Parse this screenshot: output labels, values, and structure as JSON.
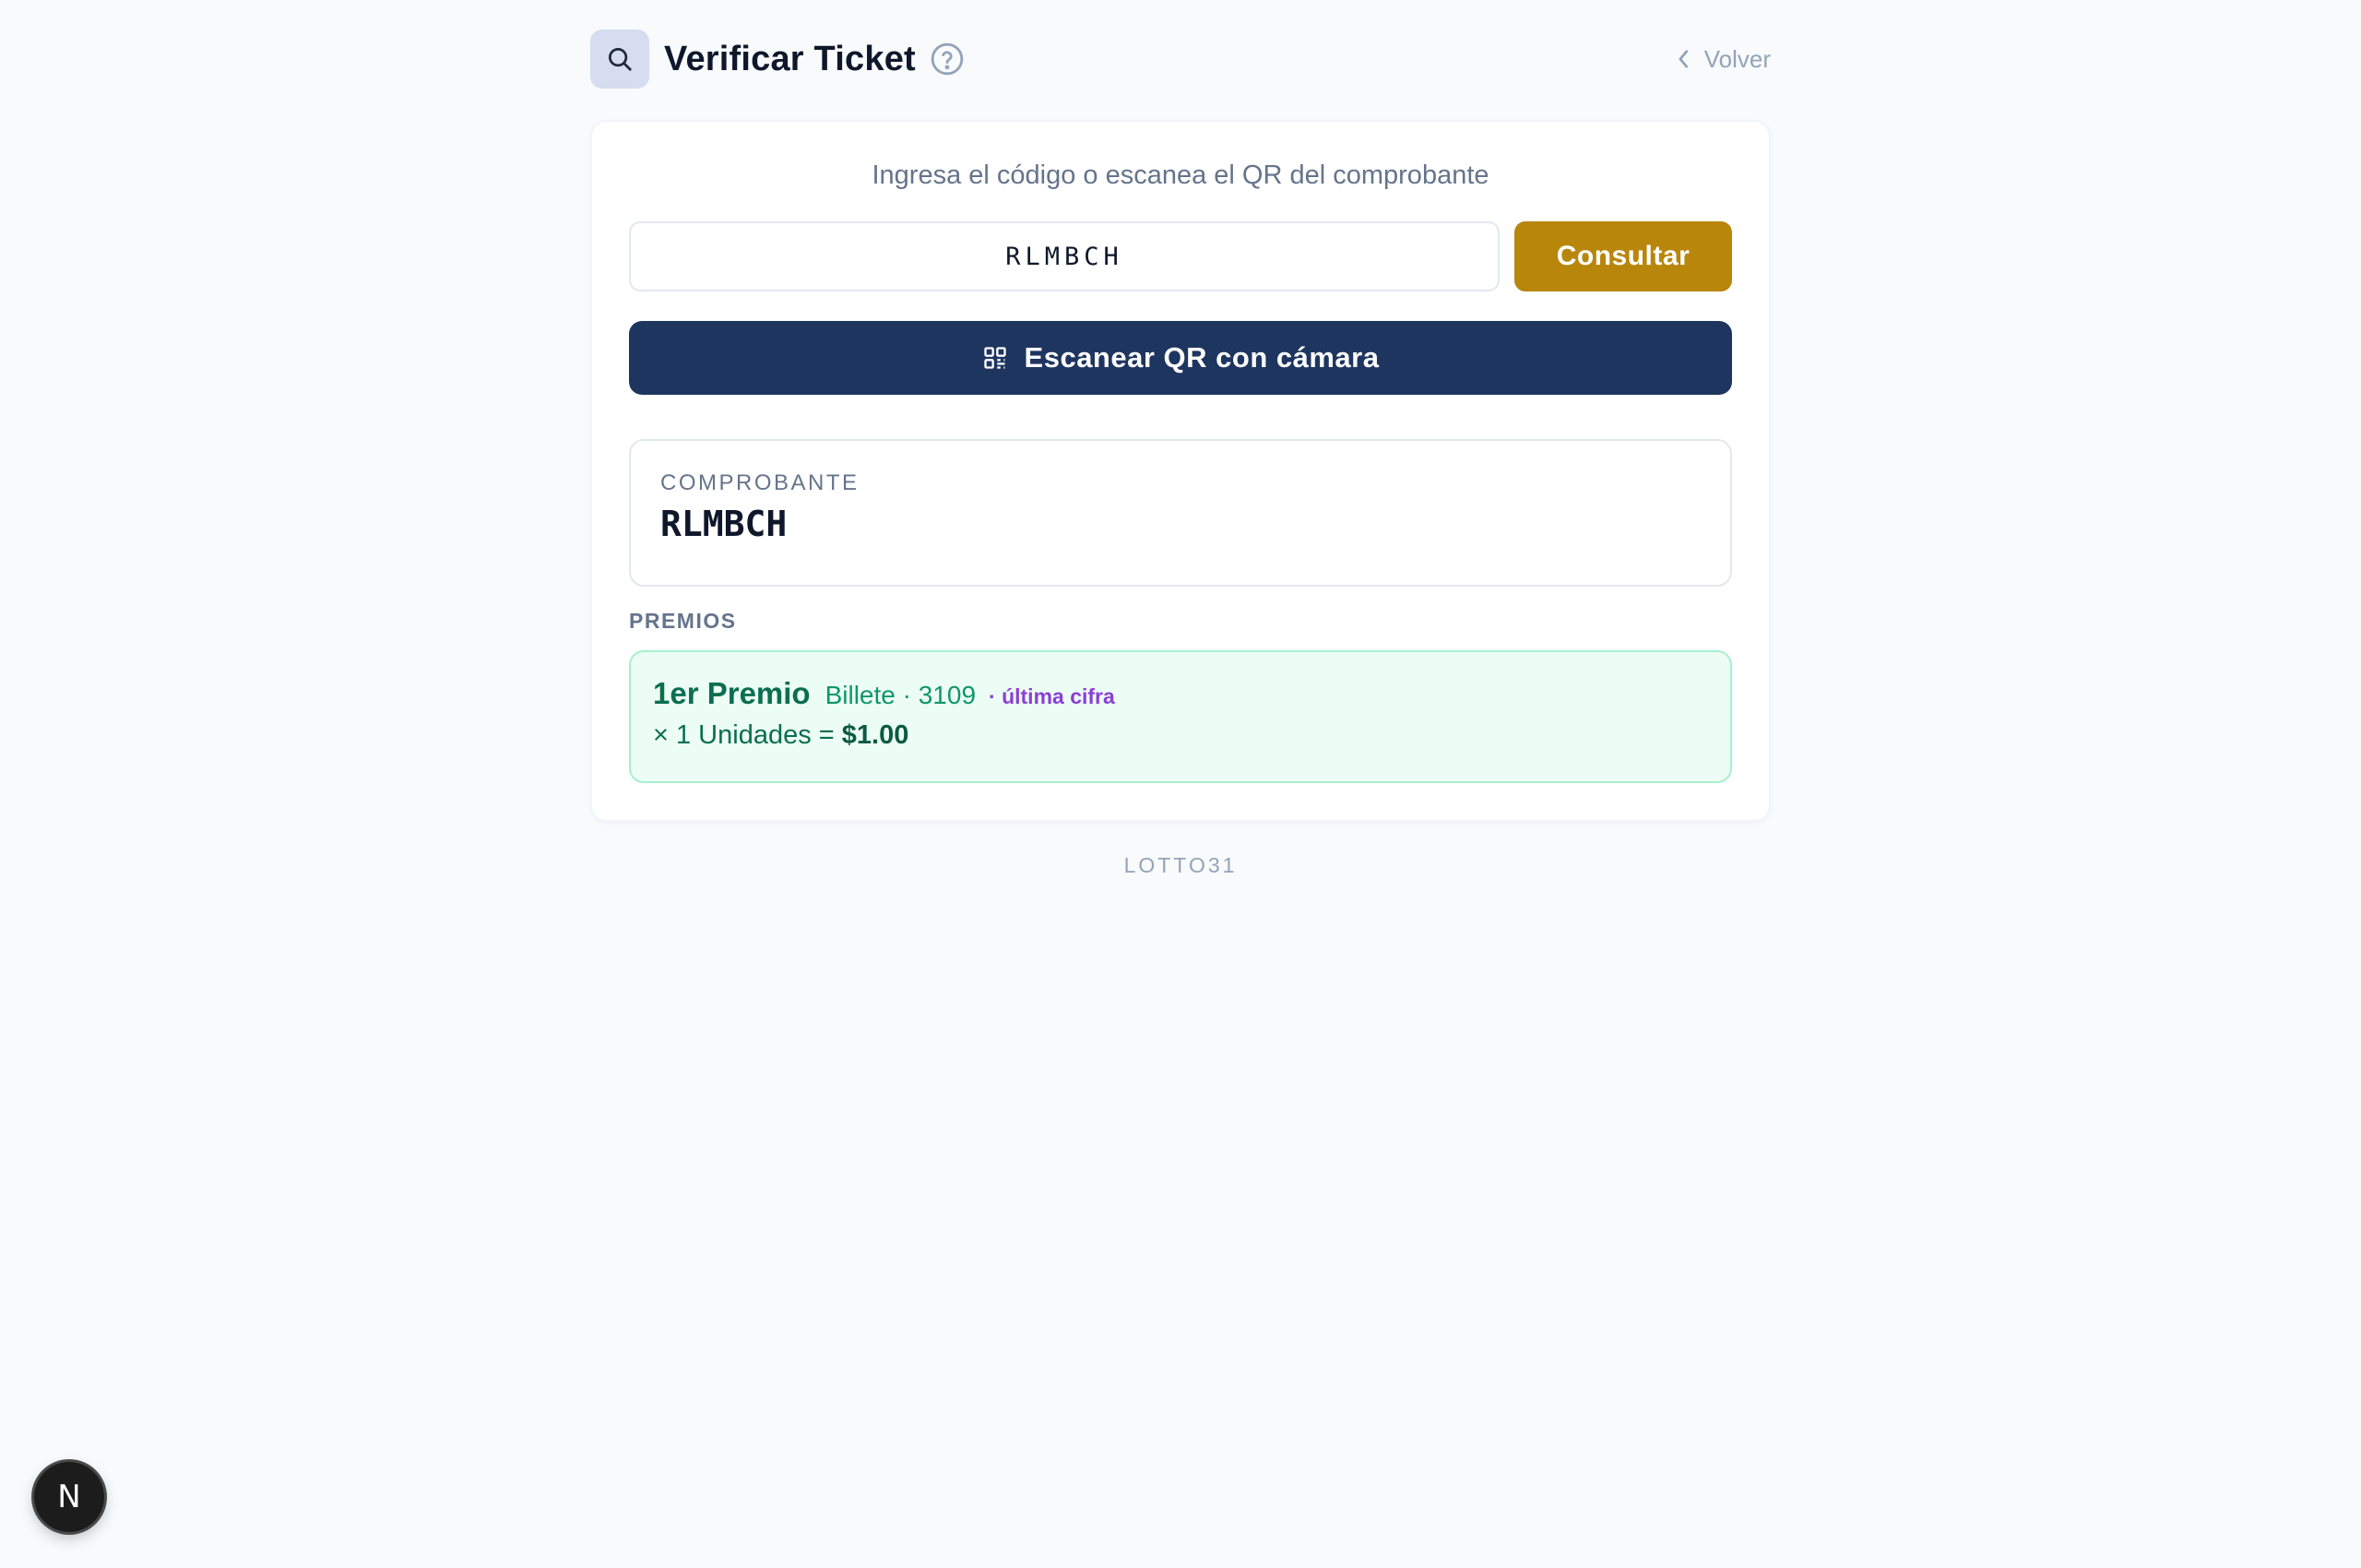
{
  "header": {
    "title": "Verificar Ticket",
    "back_label": "Volver"
  },
  "card": {
    "instructions": "Ingresa el código o escanea el QR del comprobante",
    "code_input_value": "RLMBCH",
    "consult_label": "Consultar",
    "scan_label": "Escanear QR con cámara"
  },
  "receipt": {
    "label": "COMPROBANTE",
    "code": "RLMBCH"
  },
  "prizes": {
    "label": "PREMIOS",
    "items": [
      {
        "title": "1er Premio",
        "ticket": "Billete · 3109",
        "note": "· última cifra",
        "units": "× 1 Unidades = ",
        "amount": "$1.00"
      }
    ]
  },
  "footer": {
    "brand": "LOTTO31"
  },
  "dev_badge": {
    "letter": "N"
  },
  "colors": {
    "accent_gold": "#b8860b",
    "navy": "#1e3560",
    "prize_green": "#0b6e4f",
    "prize_bg": "#ecfdf5",
    "note_purple": "#8b3fd6"
  },
  "icons": {
    "header": "search-icon",
    "help": "question-circle-icon",
    "back": "chevron-left-icon",
    "scan": "qr-code-icon"
  }
}
